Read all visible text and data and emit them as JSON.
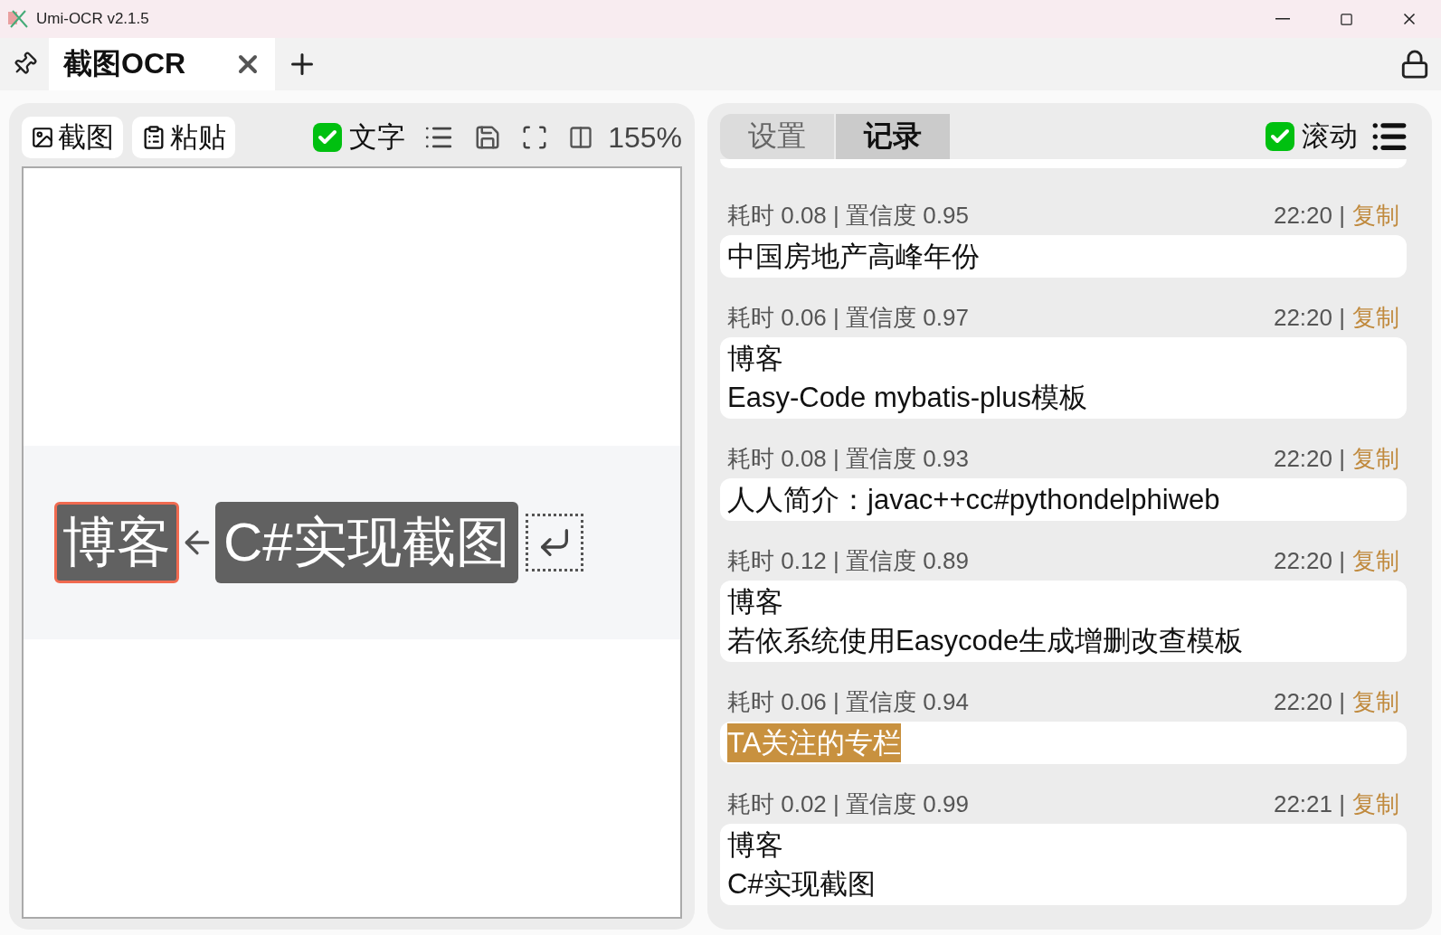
{
  "window": {
    "title": "Umi-OCR v2.1.5"
  },
  "tabs": [
    {
      "label": "截图OCR",
      "selected": true
    }
  ],
  "left_toolbar": {
    "buttons": [
      {
        "label": "截图"
      },
      {
        "label": "粘贴"
      }
    ],
    "text_toggle": {
      "label": "文字",
      "checked": true
    },
    "zoom": "155%"
  },
  "preview": {
    "overlays": [
      {
        "text": "博客",
        "selected": true
      },
      {
        "text": "C#实现截图",
        "selected": false
      }
    ]
  },
  "right_tabs": [
    {
      "label": "设置",
      "selected": false
    },
    {
      "label": "记录",
      "selected": true
    }
  ],
  "scroll_toggle": {
    "label": "滚动",
    "checked": true
  },
  "records": [
    {
      "meta": "耗时 0.08 | 置信度 0.95",
      "time": "22:20 |",
      "copy": "复制",
      "lines": [
        {
          "text": "中国房地产高峰年份",
          "highlighted": false
        }
      ]
    },
    {
      "meta": "耗时 0.06 | 置信度 0.97",
      "time": "22:20 |",
      "copy": "复制",
      "lines": [
        {
          "text": "博客",
          "highlighted": false
        },
        {
          "text": "Easy-Code mybatis-plus模板",
          "highlighted": false
        }
      ]
    },
    {
      "meta": "耗时 0.08 | 置信度 0.93",
      "time": "22:20 |",
      "copy": "复制",
      "lines": [
        {
          "text": "人人简介：javac++cc#pythondelphiweb",
          "highlighted": false
        }
      ]
    },
    {
      "meta": "耗时 0.12 | 置信度 0.89",
      "time": "22:20 |",
      "copy": "复制",
      "lines": [
        {
          "text": "博客",
          "highlighted": false
        },
        {
          "text": "若依系统使用Easycode生成增删改查模板",
          "highlighted": false
        }
      ]
    },
    {
      "meta": "耗时 0.06 | 置信度 0.94",
      "time": "22:20 |",
      "copy": "复制",
      "lines": [
        {
          "text": "TA关注的专栏",
          "highlighted": true
        }
      ]
    },
    {
      "meta": "耗时 0.02 | 置信度 0.99",
      "time": "22:21 |",
      "copy": "复制",
      "lines": [
        {
          "text": "博客",
          "highlighted": false
        },
        {
          "text": "C#实现截图",
          "highlighted": false
        }
      ]
    }
  ]
}
